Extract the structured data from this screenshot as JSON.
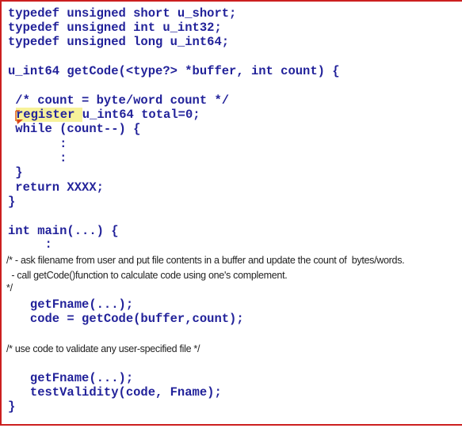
{
  "code": {
    "typedefs": [
      "typedef unsigned short u_short;",
      "typedef unsigned int u_int32;",
      "typedef unsigned long u_int64;"
    ],
    "func_sig": "u_int64 getCode(<type?> *buffer, int count) {",
    "comment_count": " /* count = byte/word count */",
    "register_kw": "register ",
    "register_rest": "u_int64 total=0;",
    "while_line": " while (count--) {",
    "ellipsis1": "       :",
    "ellipsis2": "       :",
    "close_while": " }",
    "return_line": " return XXXX;",
    "close_func": "}",
    "main_sig": "int main(...) {",
    "main_ellipsis": "     :",
    "main_comment_1": "/* - ask filename from user and put file contents in a buffer and update the count of  bytes/words.",
    "main_comment_2": "  - call getCode()function to calculate code using one's complement.",
    "main_comment_3": "*/",
    "getfname_1": "   getFname(...);",
    "code_assign": "   code = getCode(buffer,count);",
    "validate_comment": "/* use code to validate any user-specified file */",
    "getfname_2": "   getFname(...);",
    "test_validity": "   testValidity(code, Fname);",
    "close_main": "}"
  },
  "colors": {
    "code": "#22229a",
    "border": "#cc1f1f",
    "highlight": "#f7f29a",
    "comment_marker": "#e05a1a"
  }
}
